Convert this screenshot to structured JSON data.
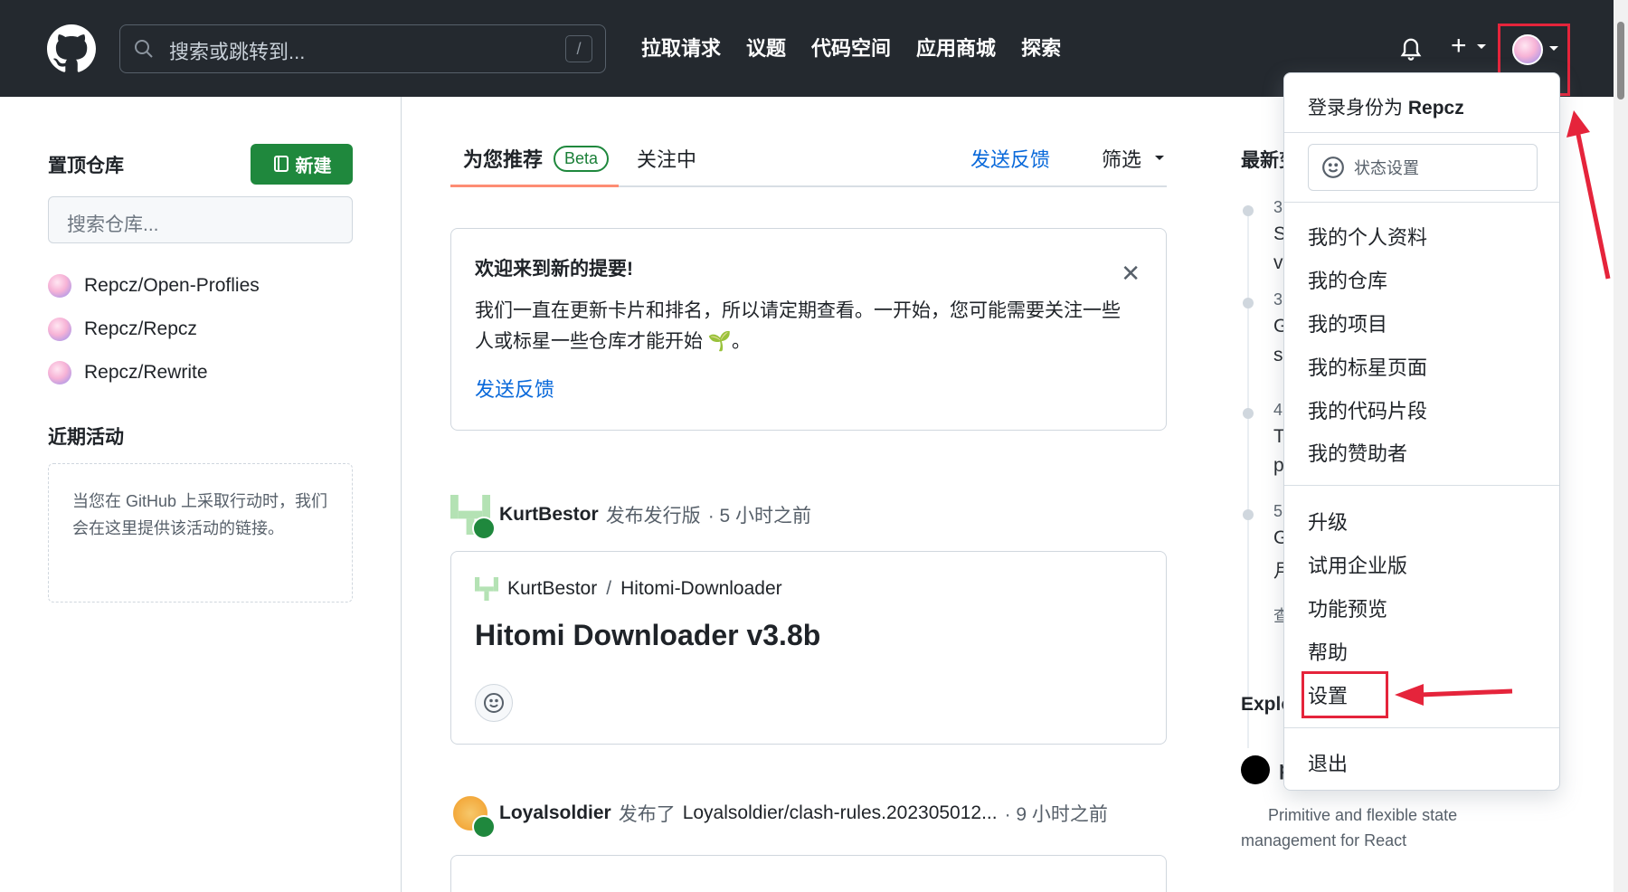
{
  "header": {
    "search_placeholder": "搜索或跳转到...",
    "slash_key": "/",
    "nav": [
      "拉取请求",
      "议题",
      "代码空间",
      "应用商城",
      "探索"
    ]
  },
  "sidebar": {
    "pinned_title": "置顶仓库",
    "new_button": "新建",
    "repo_search_placeholder": "搜索仓库...",
    "repos": [
      "Repcz/Open-Proflies",
      "Repcz/Repcz",
      "Repcz/Rewrite"
    ],
    "recent_title": "近期活动",
    "recent_empty": "当您在 GitHub 上采取行动时，我们会在这里提供该活动的链接。"
  },
  "feed": {
    "tab_recommended": "为您推荐",
    "beta": "Beta",
    "tab_following": "关注中",
    "feedback": "发送反馈",
    "filter": "筛选",
    "welcome_title": "欢迎来到新的提要!",
    "welcome_body": "我们一直在更新卡片和排名，所以请定期查看。一开始，您可能需要关注一些人或标星一些仓库才能开始 🌱。",
    "welcome_feedback": "发送反馈",
    "event1_user": "KurtBestor",
    "event1_action": "发布发行版",
    "event1_time": "· 5 小时之前",
    "release_owner": "KurtBestor",
    "release_sep": "/",
    "release_repo": "Hitomi-Downloader",
    "release_title": "Hitomi Downloader v3.8b",
    "event2_user": "Loyalsoldier",
    "event2_action": "发布了",
    "event2_target": "Loyalsoldier/clash-rules.202305012...",
    "event2_time": "· 9 小时之前"
  },
  "right": {
    "latest_title": "最新变",
    "explore_title": "Explo",
    "explore_item": "p",
    "explore_desc": "Primitive and flexible state management for React",
    "timeline_nums": [
      "3",
      "3",
      "4",
      "5"
    ],
    "timeline_letters": [
      [
        "S",
        "v"
      ],
      [
        "G",
        "s"
      ],
      [
        "T",
        "p"
      ],
      [
        "G",
        "月"
      ]
    ],
    "timeline_more": "查"
  },
  "dropdown": {
    "signed_in_prefix": "登录身份为",
    "username": "Repcz",
    "status": "状态设置",
    "group1": [
      "我的个人资料",
      "我的仓库",
      "我的项目",
      "我的标星页面",
      "我的代码片段",
      "我的赞助者"
    ],
    "group2": [
      "升级",
      "试用企业版",
      "功能预览",
      "帮助",
      "设置"
    ],
    "signout": "退出"
  },
  "colors": {
    "header_bg": "#24292f",
    "primary_green": "#1f883d",
    "link_blue": "#0969da",
    "annotation_red": "#e5243b"
  }
}
